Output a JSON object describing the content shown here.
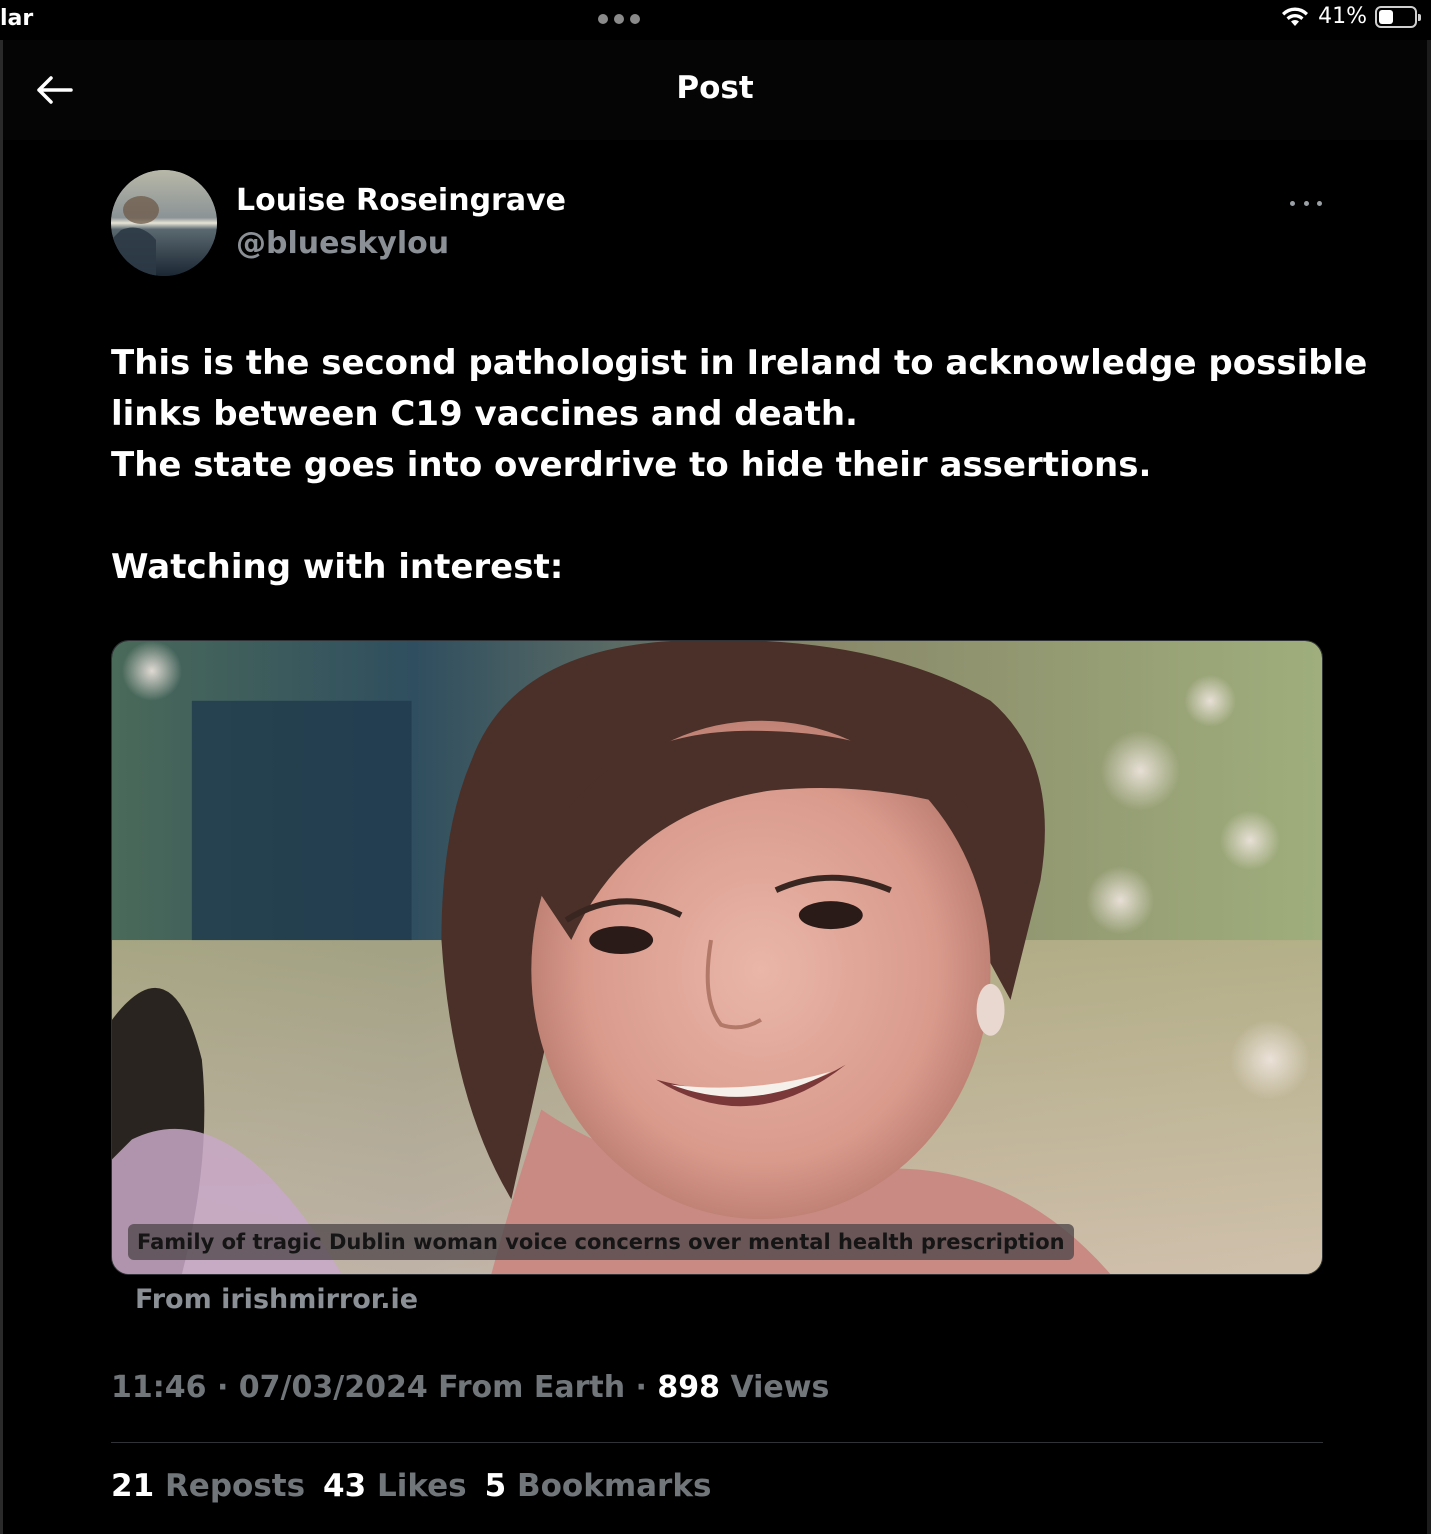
{
  "status_bar": {
    "carrier": "lar",
    "battery_percent": "41%",
    "battery_level": 0.41,
    "icons": [
      "wifi-icon",
      "battery-icon"
    ]
  },
  "header": {
    "title": "Post",
    "back_icon": "arrow-left-icon"
  },
  "post": {
    "author_name": "Louise Roseingrave",
    "author_handle": "@blueskylou",
    "more_icon": "more-horizontal-icon",
    "text_lines": [
      "This is the second pathologist in Ireland to acknowledge possible",
      "links between C19 vaccines and death.",
      "The state goes into overdrive to hide their assertions.",
      "Watching with interest:"
    ],
    "card": {
      "caption": "Family of tragic Dublin woman voice concerns over mental health prescription",
      "source": "From irishmirror.ie"
    },
    "meta": {
      "time": "11:46",
      "separator": " · ",
      "date": "07/03/2024",
      "location": "From Earth",
      "views_count": "898",
      "views_label": "Views"
    },
    "stats": {
      "reposts_count": "21",
      "reposts_label": "Reposts",
      "likes_count": "43",
      "likes_label": "Likes",
      "bookmarks_count": "5",
      "bookmarks_label": "Bookmarks"
    }
  },
  "colors": {
    "background": "#000000",
    "text_primary": "#ffffff",
    "text_secondary": "#71767b",
    "divider": "#2f3336"
  }
}
